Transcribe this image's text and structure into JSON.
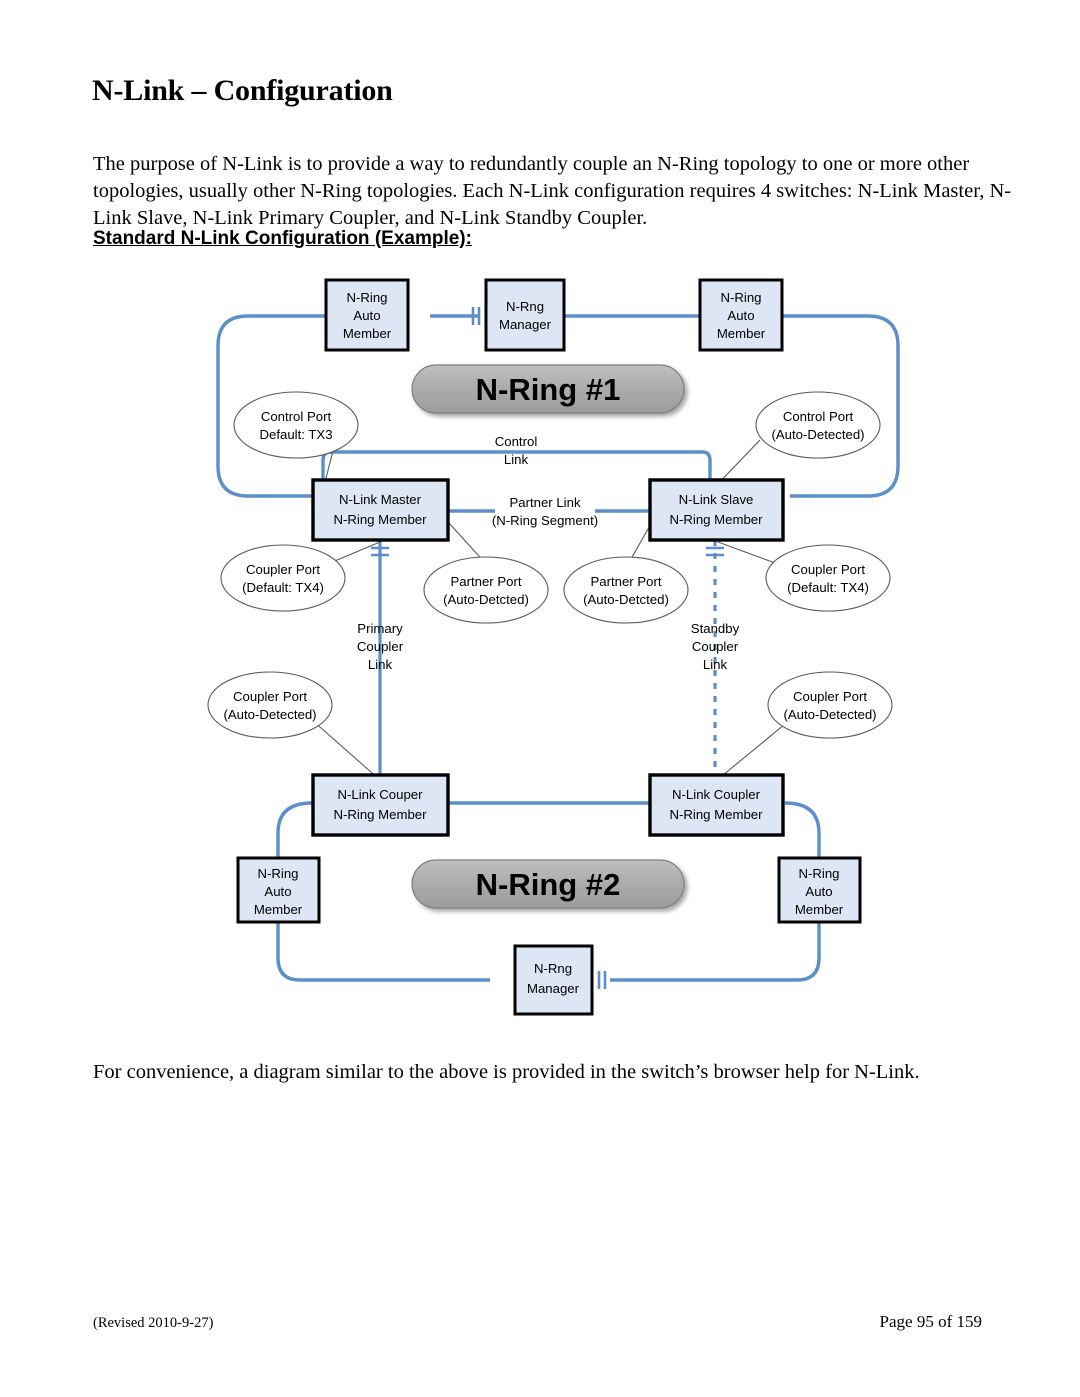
{
  "document": {
    "title": "N-Link – Configuration",
    "intro": "The purpose of N-Link is to provide a way to redundantly couple an N-Ring topology to one or more other topologies, usually other N-Ring topologies.  Each N-Link configuration requires 4 switches:  N-Link Master, N-Link Slave, N-Link Primary Coupler, and N-Link Standby Coupler.",
    "subheading": "Standard N-Link Configuration (Example):",
    "closing": "For convenience, a diagram similar to the above is provided in the switch’s browser help for N-Link.",
    "footer_left": "(Revised 2010-9-27)",
    "footer_right": "Page 95 of 159"
  },
  "colors": {
    "ring_line": "#5B8FC9",
    "node_fill": "#DCE6F4",
    "node_border": "#000000",
    "banner_fill": "#ABABAB",
    "banner_stroke": "#7F7F7F",
    "callout_stroke": "#595959",
    "leader_stroke": "#595959",
    "page_background": "#FFFFFF"
  },
  "diagram": {
    "name": "standard-n-link-configuration",
    "banners": [
      {
        "id": "ring1",
        "label": "N-Ring #1"
      },
      {
        "id": "ring2",
        "label": "N-Ring #2"
      }
    ],
    "nodes": [
      {
        "id": "ring1-member-left",
        "lines": [
          "N-Ring",
          "Auto",
          "Member"
        ]
      },
      {
        "id": "ring1-manager",
        "lines": [
          "N-Rng",
          "Manager"
        ]
      },
      {
        "id": "ring1-member-right",
        "lines": [
          "N-Ring",
          "Auto",
          "Member"
        ]
      },
      {
        "id": "nlink-master",
        "lines": [
          "N-Link Master",
          "N-Ring Member"
        ]
      },
      {
        "id": "nlink-slave",
        "lines": [
          "N-Link Slave",
          "N-Ring Member"
        ]
      },
      {
        "id": "nlink-coupler-primary",
        "lines": [
          "N-Link Couper",
          "N-Ring Member"
        ]
      },
      {
        "id": "nlink-coupler-standby",
        "lines": [
          "N-Link Coupler",
          "N-Ring Member"
        ]
      },
      {
        "id": "ring2-member-left",
        "lines": [
          "N-Ring",
          "Auto",
          "Member"
        ]
      },
      {
        "id": "ring2-member-right",
        "lines": [
          "N-Ring",
          "Auto",
          "Member"
        ]
      },
      {
        "id": "ring2-manager",
        "lines": [
          "N-Rng",
          "Manager"
        ]
      }
    ],
    "callouts": [
      {
        "id": "control-port-master",
        "lines": [
          "Control Port",
          "Default: TX3"
        ]
      },
      {
        "id": "control-port-slave",
        "lines": [
          "Control Port",
          "(Auto-Detected)"
        ]
      },
      {
        "id": "coupler-port-master",
        "lines": [
          "Coupler Port",
          "(Default: TX4)"
        ]
      },
      {
        "id": "partner-port-master",
        "lines": [
          "Partner Port",
          "(Auto-Detcted)"
        ]
      },
      {
        "id": "partner-port-slave",
        "lines": [
          "Partner Port",
          "(Auto-Detcted)"
        ]
      },
      {
        "id": "coupler-port-slave",
        "lines": [
          "Coupler Port",
          "(Default: TX4)"
        ]
      },
      {
        "id": "coupler-port-primary",
        "lines": [
          "Coupler Port",
          "(Auto-Detected)"
        ]
      },
      {
        "id": "coupler-port-standby",
        "lines": [
          "Coupler Port",
          "(Auto-Detected)"
        ]
      }
    ],
    "link_labels": [
      {
        "id": "control-link",
        "lines": [
          "Control",
          "Link"
        ]
      },
      {
        "id": "partner-link",
        "lines": [
          "Partner Link",
          "(N-Ring Segment)"
        ]
      },
      {
        "id": "primary-coupler-link",
        "lines": [
          "Primary",
          "Coupler",
          "Link"
        ]
      },
      {
        "id": "standby-coupler-link",
        "lines": [
          "Standby",
          "Coupler",
          "Link"
        ]
      }
    ]
  }
}
